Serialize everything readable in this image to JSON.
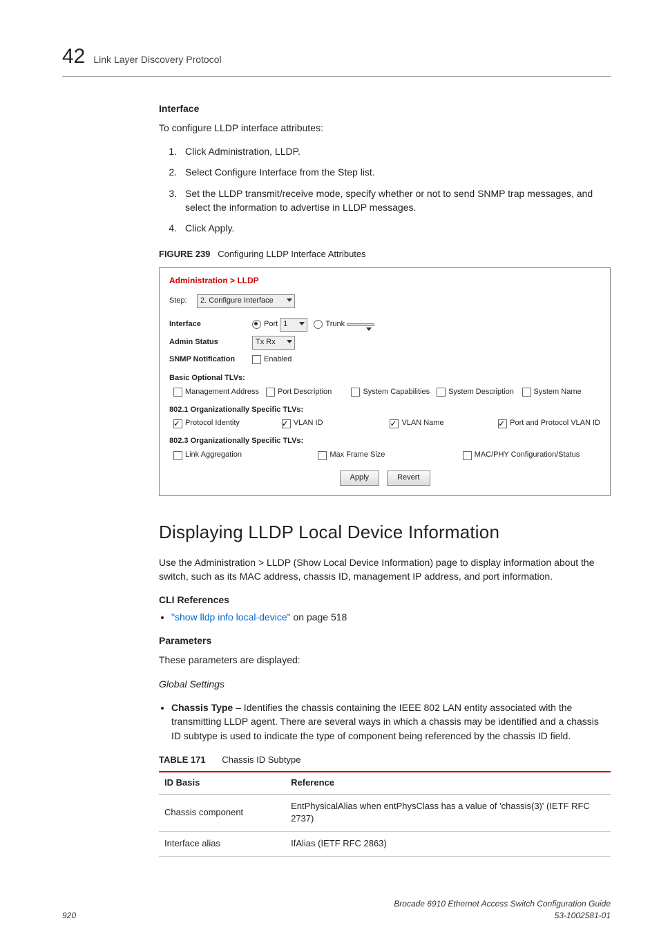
{
  "header": {
    "chapter_num": "42",
    "chapter_title": "Link Layer Discovery Protocol"
  },
  "section_interface": {
    "heading": "Interface",
    "intro": "To configure LLDP interface attributes:",
    "steps": [
      "Click Administration, LLDP.",
      "Select Configure Interface from the Step list.",
      "Set the LLDP transmit/receive mode, specify whether or not to send SNMP trap messages, and select the information to advertise in LLDP messages.",
      "Click Apply."
    ]
  },
  "figure": {
    "label": "FIGURE 239",
    "caption": "Configuring LLDP Interface Attributes",
    "ui": {
      "breadcrumb": "Administration > LLDP",
      "step_label": "Step:",
      "step_value": "2. Configure Interface",
      "interface_label": "Interface",
      "port_label": "Port",
      "port_value": "1",
      "trunk_label": "Trunk",
      "admin_status_label": "Admin Status",
      "admin_status_value": "Tx Rx",
      "snmp_notif_label": "SNMP Notification",
      "enabled_label": "Enabled",
      "basic_tlv_head": "Basic Optional TLVs:",
      "basic_tlvs": {
        "management_address": "Management Address",
        "port_description": "Port Description",
        "system_capabilities": "System Capabilities",
        "system_description": "System Description",
        "system_name": "System Name"
      },
      "dot1_head": "802.1 Organizationally Specific TLVs:",
      "dot1_tlvs": {
        "protocol_identity": "Protocol Identity",
        "vlan_id": "VLAN ID",
        "vlan_name": "VLAN Name",
        "port_proto_vlan": "Port and Protocol VLAN ID"
      },
      "dot3_head": "802.3 Organizationally Specific TLVs:",
      "dot3_tlvs": {
        "link_aggregation": "Link Aggregation",
        "max_frame_size": "Max Frame Size",
        "mac_phy": "MAC/PHY Configuration/Status"
      },
      "apply_btn": "Apply",
      "revert_btn": "Revert"
    }
  },
  "section_display": {
    "heading": "Displaying LLDP Local Device Information",
    "para": "Use the Administration > LLDP (Show Local Device Information) page to display information about the switch, such as its MAC address, chassis ID, management IP address, and port information.",
    "cli_ref_head": "CLI References",
    "cli_link_text": "\"show lldp info local-device\"",
    "cli_link_suffix": " on page 518",
    "params_head": "Parameters",
    "params_intro": "These parameters are displayed:",
    "global_settings": "Global Settings",
    "chassis_bullet_lead": "Chassis Type",
    "chassis_bullet_text": " – Identifies the chassis containing the IEEE 802 LAN entity associated with the transmitting LLDP agent. There are several ways in which a chassis may be identified and a chassis ID subtype is used to indicate the type of component being referenced by the chassis ID field."
  },
  "table": {
    "label": "TABLE 171",
    "caption": "Chassis ID Subtype",
    "head_col1": "ID Basis",
    "head_col2": "Reference",
    "rows": [
      {
        "c1": "Chassis component",
        "c2": "EntPhysicalAlias when entPhysClass has a value of 'chassis(3)' (IETF RFC 2737)"
      },
      {
        "c1": "Interface alias",
        "c2": "IfAlias (IETF RFC 2863)"
      }
    ]
  },
  "footer": {
    "page": "920",
    "doc_title": "Brocade 6910 Ethernet Access Switch Configuration Guide",
    "doc_num": "53-1002581-01"
  }
}
